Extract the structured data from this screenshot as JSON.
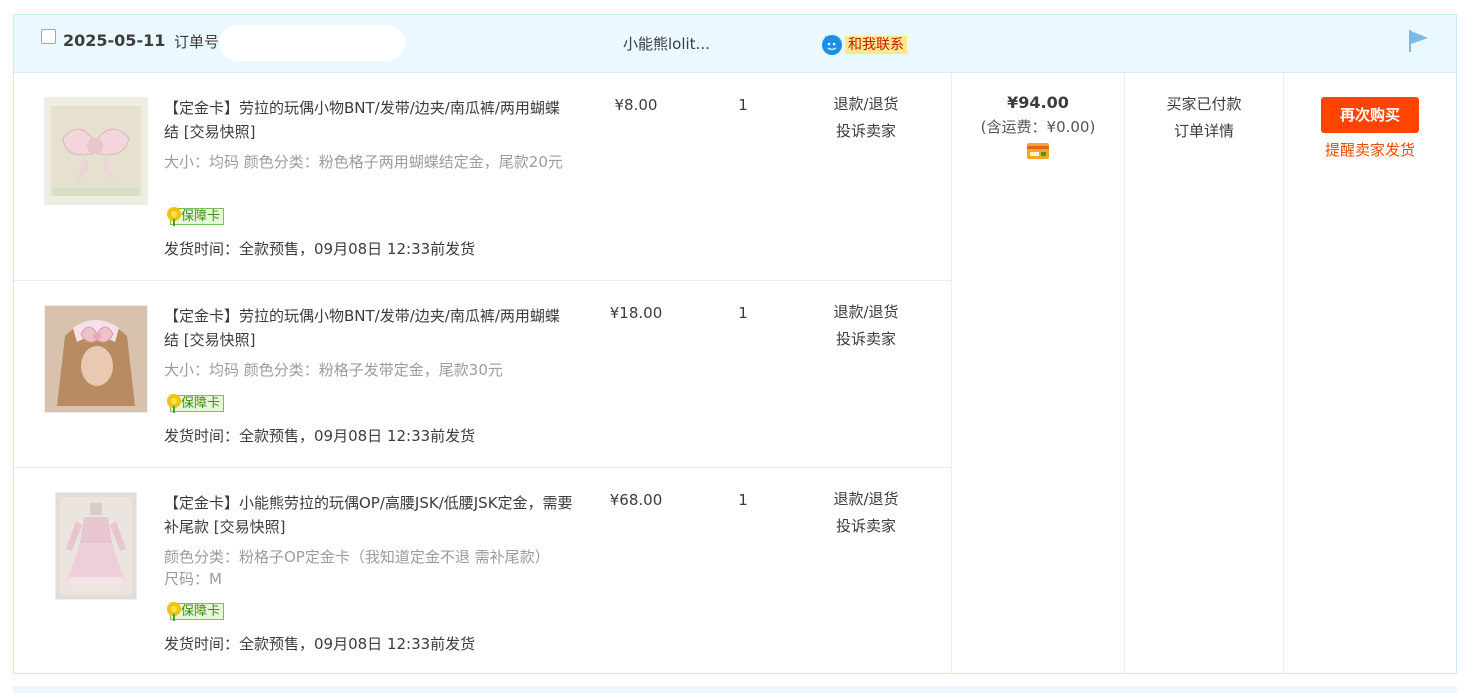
{
  "order": {
    "date": "2025-05-11",
    "order_no_label": "订单号",
    "shop_name": "小能熊lolit...",
    "contact_label": "和我联系",
    "total": "¥94.00",
    "freight": "(含运费：¥0.00)",
    "status": "买家已付款",
    "detail_link": "订单详情",
    "rebuy_button": "再次购买",
    "remind_link": "提醒卖家发货"
  },
  "items": [
    {
      "title": "【定金卡】劳拉的玩偶小物BNT/发带/边夹/南瓜裤/两用蝴蝶结",
      "snapshot": "[交易快照]",
      "spec": "大小：均码   颜色分类：粉色格子两用蝴蝶结定金，尾款20元",
      "badge": "保障卡",
      "ship": "发货时间：全款预售，09月08日 12:33前发货",
      "price": "¥8.00",
      "qty": "1",
      "refund": "退款/退货",
      "complain": "投诉卖家"
    },
    {
      "title": "【定金卡】劳拉的玩偶小物BNT/发带/边夹/南瓜裤/两用蝴蝶结",
      "snapshot": "[交易快照]",
      "spec": "大小：均码   颜色分类：粉格子发带定金，尾款30元",
      "badge": "保障卡",
      "ship": "发货时间：全款预售，09月08日 12:33前发货",
      "price": "¥18.00",
      "qty": "1",
      "refund": "退款/退货",
      "complain": "投诉卖家"
    },
    {
      "title": "【定金卡】小能熊劳拉的玩偶OP/高腰JSK/低腰JSK定金，需要补尾款",
      "snapshot": "[交易快照]",
      "spec": "颜色分类：粉格子OP定金卡（我知道定金不退 需补尾款）   尺码：M",
      "badge": "保障卡",
      "ship": "发货时间：全款预售，09月08日 12:33前发货",
      "price": "¥68.00",
      "qty": "1",
      "refund": "退款/退货",
      "complain": "投诉卖家"
    }
  ],
  "colors": {
    "header_bg": "#eaf8ff",
    "accent": "#ff4400",
    "badge_green": "#7cc05a"
  }
}
